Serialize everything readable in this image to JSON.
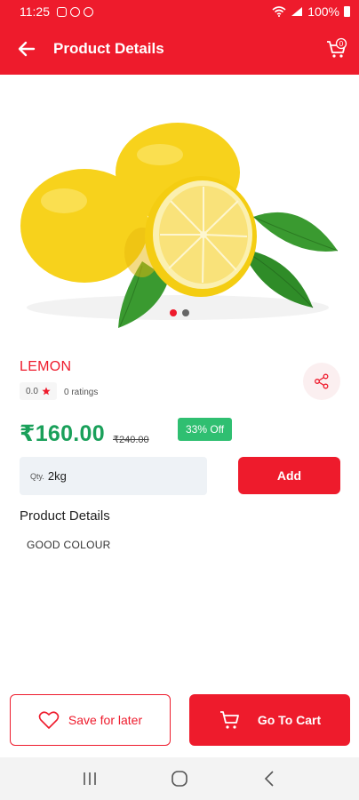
{
  "status_bar": {
    "time": "11:25",
    "battery": "100%"
  },
  "header": {
    "title": "Product Details",
    "cart_count": "0"
  },
  "product": {
    "name": "LEMON",
    "rating": "0.0",
    "ratings_count": "0 ratings",
    "price": "₹160.00",
    "old_price": "₹240.00",
    "discount": "33% Off",
    "qty_label": "Qty.",
    "qty_value": "2kg",
    "add_label": "Add",
    "details_heading": "Product Details",
    "details_text": "GOOD COLOUR"
  },
  "carousel": {
    "count": 2,
    "active": 1
  },
  "actions": {
    "save_label": "Save for later",
    "cart_label": "Go To Cart"
  },
  "colors": {
    "brand": "#ee1b2c",
    "price_green": "#1aa05a",
    "discount_green": "#2fbf71"
  },
  "icons": [
    "back-arrow-icon",
    "cart-icon",
    "share-icon",
    "star-icon",
    "heart-icon",
    "recents-icon",
    "home-icon",
    "back-nav-icon"
  ]
}
